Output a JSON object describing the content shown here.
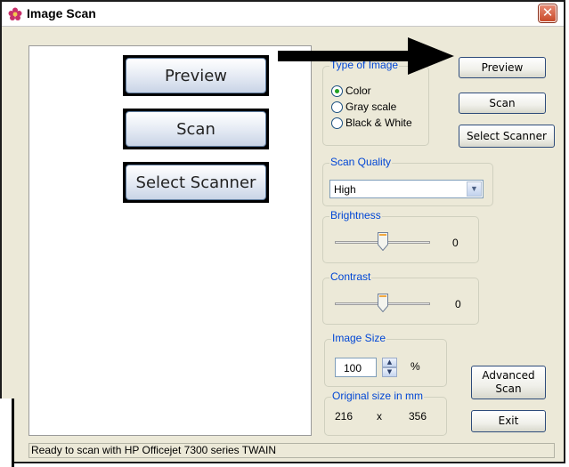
{
  "window": {
    "title": "Image Scan",
    "close_glyph": "✕",
    "app_icon": "flower-icon"
  },
  "zoomed_buttons": {
    "preview": "Preview",
    "scan": "Scan",
    "select_scanner": "Select Scanner"
  },
  "type_of_image": {
    "legend": "Type of Image",
    "options": [
      "Color",
      "Gray scale",
      "Black & White"
    ],
    "selected": "Color"
  },
  "buttons": {
    "preview": "Preview",
    "scan": "Scan",
    "select_scanner": "Select Scanner",
    "advanced_scan_line1": "Advanced",
    "advanced_scan_line2": "Scan",
    "exit": "Exit"
  },
  "scan_quality": {
    "legend": "Scan Quality",
    "value": "High"
  },
  "brightness": {
    "legend": "Brightness",
    "value": "0",
    "level_fraction": 0.5
  },
  "contrast": {
    "legend": "Contrast",
    "value": "0",
    "level_fraction": 0.5
  },
  "image_size": {
    "legend": "Image Size",
    "value": "100",
    "unit": "%"
  },
  "original_size": {
    "legend": "Original size in mm",
    "width": "216",
    "separator": "x",
    "height": "356"
  },
  "status_text": "Ready to scan with HP Officejet 7300 series TWAIN",
  "colors": {
    "legend_blue": "#0046d5",
    "radio_dot": "#21a121",
    "close_red": "#c84a2a"
  }
}
